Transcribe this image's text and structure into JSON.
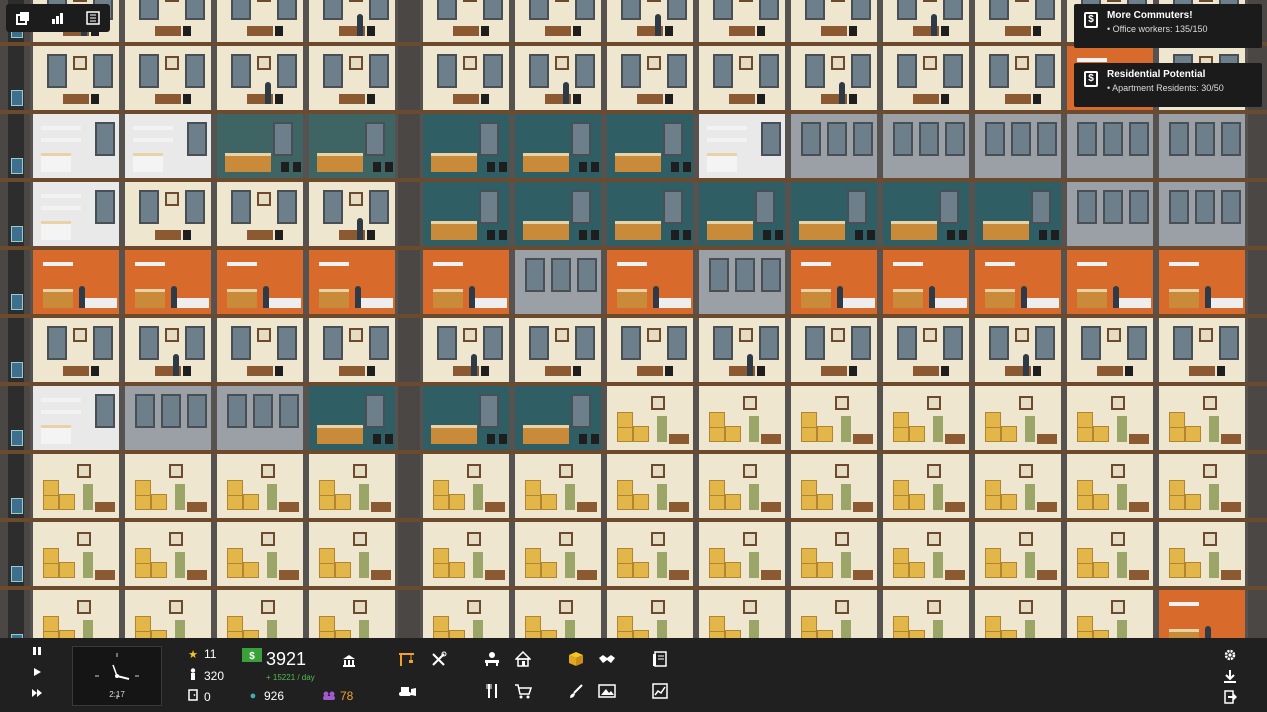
{
  "top_toolbar": {
    "icons": [
      "overview-icon",
      "ratings-icon",
      "building-list-icon"
    ]
  },
  "notifications": [
    {
      "title": "More Commuters!",
      "line": "Office workers: 135/150",
      "icon": "$"
    },
    {
      "title": "Residential Potential",
      "line": "Apartment Residents: 30/50",
      "icon": "$"
    }
  ],
  "bottom_bar": {
    "clock_time": "2:17",
    "stars": "11",
    "population": "320",
    "vacancies": "0",
    "money": "3921",
    "money_rate": "+ 15221 / day",
    "research": "926",
    "influence": "78"
  },
  "colors": {
    "money_green": "#4fbf4f",
    "influence_purple": "#a35ad1",
    "star_gold": "#f3c623",
    "research_teal": "#3fb0b5",
    "tool_orange": "#f0a02c"
  }
}
